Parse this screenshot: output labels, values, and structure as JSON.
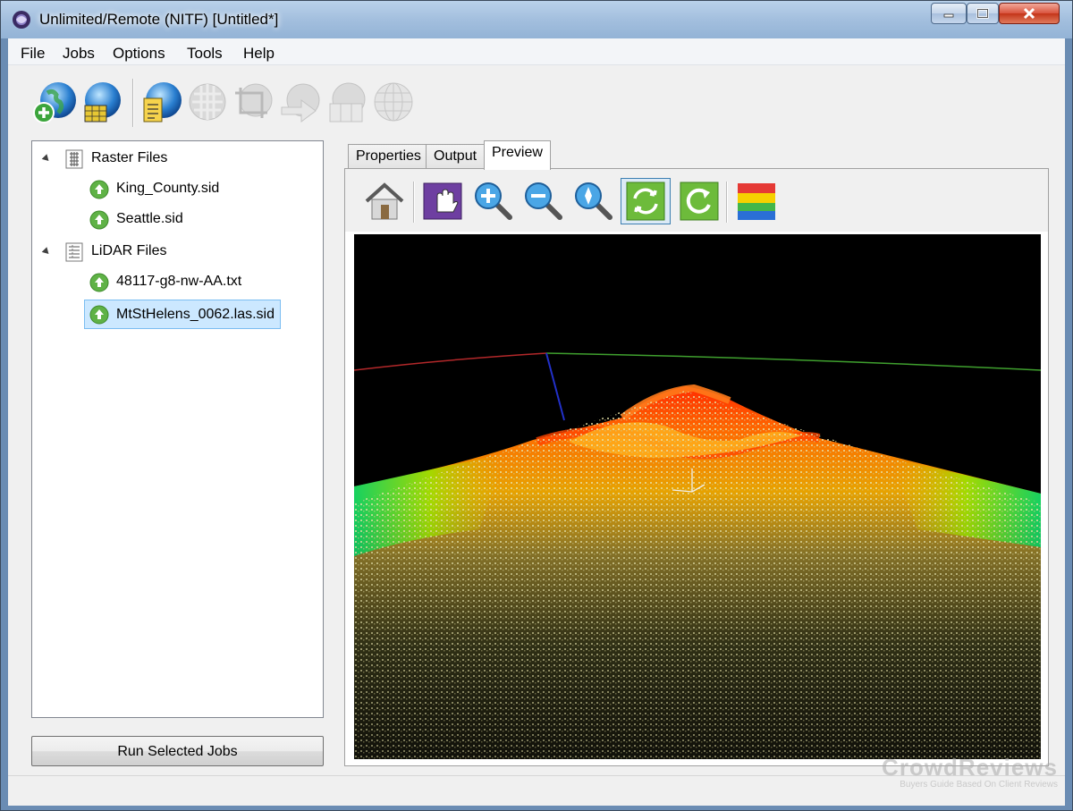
{
  "window": {
    "title": "Unlimited/Remote (NITF) [Untitled*]"
  },
  "menu": [
    "File",
    "Jobs",
    "Options",
    "Tools",
    "Help"
  ],
  "toolbar": {
    "buttons": [
      {
        "icon": "add-globe-icon",
        "enabled": true
      },
      {
        "icon": "globe-grid-icon",
        "enabled": true
      },
      {
        "icon": "globe-document-icon",
        "enabled": true
      },
      {
        "icon": "mosaic-globe-icon",
        "enabled": false
      },
      {
        "icon": "crop-globe-icon",
        "enabled": false
      },
      {
        "icon": "export-globe-icon",
        "enabled": false
      },
      {
        "icon": "tile-globe-icon",
        "enabled": false
      },
      {
        "icon": "grid-sphere-icon",
        "enabled": false
      }
    ]
  },
  "tree": {
    "groups": [
      {
        "label": "Raster Files",
        "icon": "raster-grid-icon",
        "items": [
          "King_County.sid",
          "Seattle.sid"
        ]
      },
      {
        "label": "LiDAR Files",
        "icon": "lidar-table-icon",
        "items": [
          "48117-g8-nw-AA.txt",
          "MtStHelens_0062.las.sid"
        ]
      }
    ],
    "selected": "MtStHelens_0062.las.sid"
  },
  "run_button": "Run Selected Jobs",
  "tabs": [
    "Properties",
    "Output",
    "Preview"
  ],
  "active_tab": "Preview",
  "preview_tools": [
    {
      "icon": "home-icon"
    },
    {
      "icon": "pan-hand-icon"
    },
    {
      "icon": "zoom-in-icon"
    },
    {
      "icon": "zoom-out-icon"
    },
    {
      "icon": "zoom-extent-icon"
    },
    {
      "icon": "rotate-sync-icon",
      "pressed": true
    },
    {
      "icon": "refresh-icon"
    },
    {
      "icon": "color-ramp-icon"
    }
  ],
  "watermark": {
    "brand": "CrowdReviews",
    "tagline": "Buyers Guide Based On Client Reviews"
  },
  "colors": {
    "accent": "#7bbdf1",
    "selection": "#cce8ff",
    "viewport_bg": "#000000"
  }
}
